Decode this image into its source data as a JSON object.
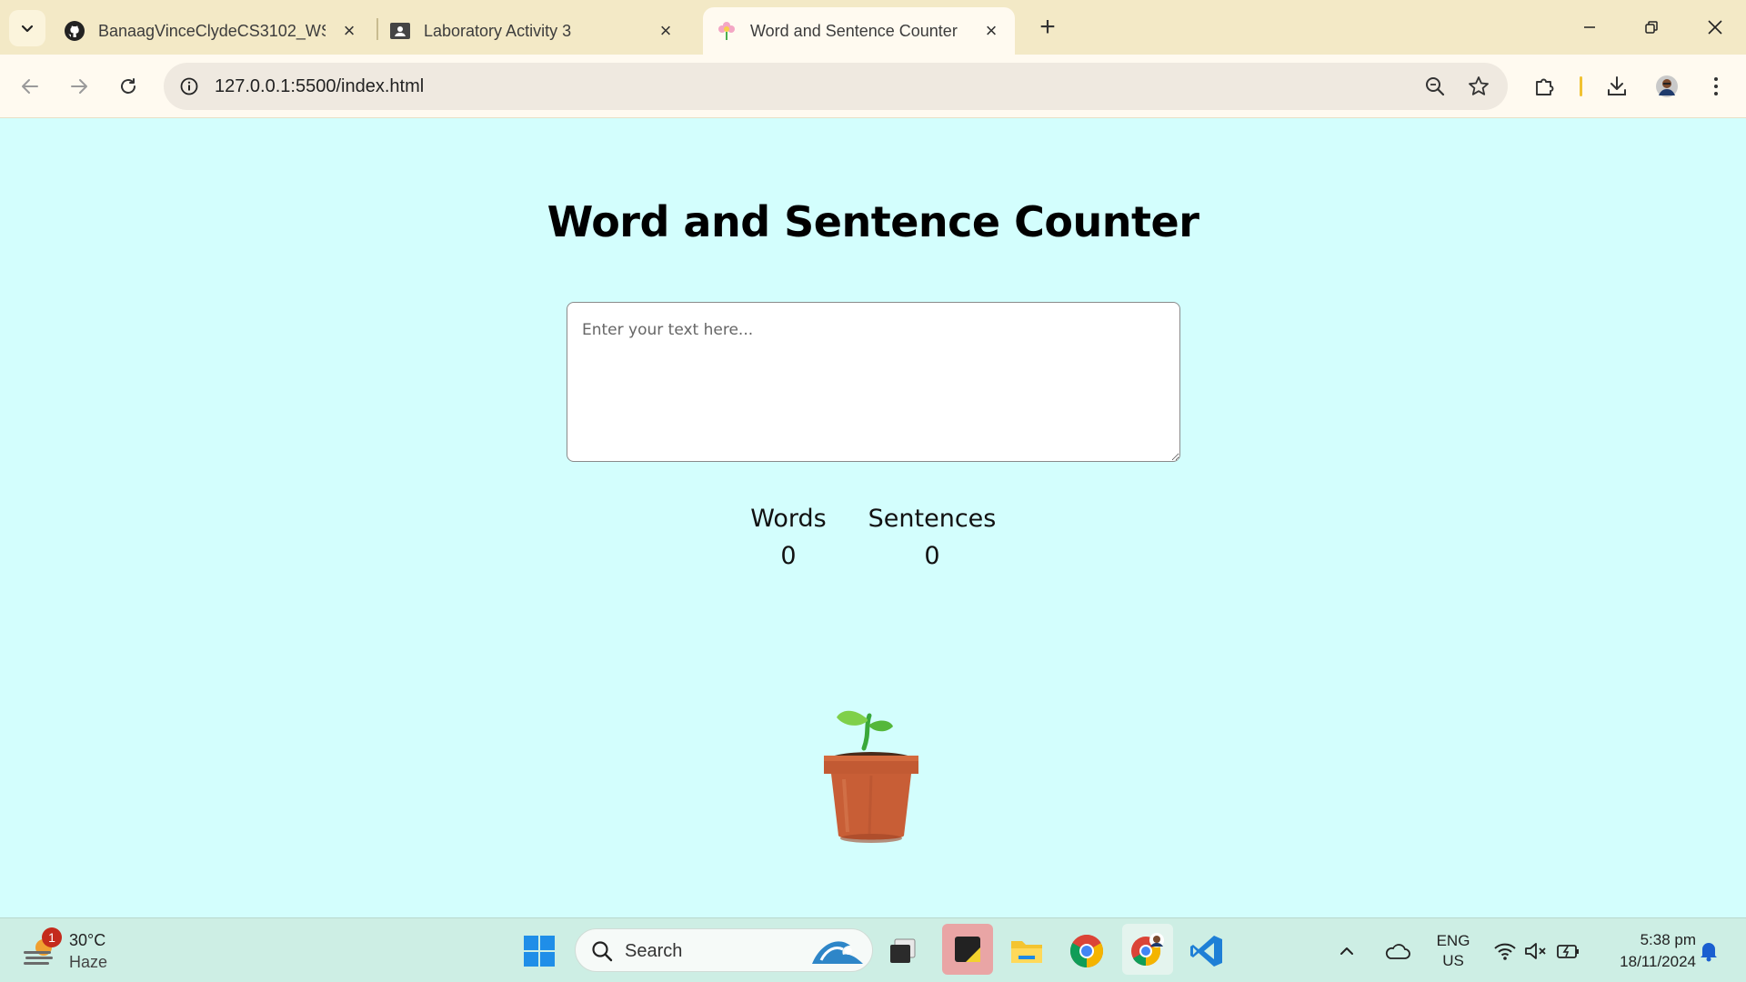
{
  "browser": {
    "tabs": [
      {
        "title": "BanaagVinceClydeCS3102_WST",
        "icon": "github-icon",
        "active": false
      },
      {
        "title": "Laboratory Activity 3",
        "icon": "classroom-icon",
        "active": false
      },
      {
        "title": "Word and Sentence Counter",
        "icon": "flower-icon",
        "active": true
      }
    ],
    "url": "127.0.0.1:5500/index.html"
  },
  "page": {
    "title": "Word and Sentence Counter",
    "textarea_placeholder": "Enter your text here...",
    "textarea_value": "",
    "stats": {
      "words_label": "Words",
      "words_value": "0",
      "sentences_label": "Sentences",
      "sentences_value": "0"
    },
    "illustration": "potted-plant-icon"
  },
  "taskbar": {
    "weather": {
      "temp": "30°C",
      "condition": "Haze",
      "badge": "1"
    },
    "search_label": "Search",
    "language": {
      "line1": "ENG",
      "line2": "US"
    },
    "clock": {
      "time": "5:38 pm",
      "date": "18/11/2024"
    },
    "apps": [
      "windows-start-icon",
      "task-view-icon",
      "sticky-notes-icon",
      "file-explorer-icon",
      "chrome-icon",
      "chrome-profile-icon",
      "vscode-icon"
    ]
  },
  "colors": {
    "page_bg": "#d3fefd",
    "tabbar_bg": "#f3e9c6",
    "toolbar_bg": "#fffaf0",
    "taskbar_bg": "#cdeee4"
  }
}
